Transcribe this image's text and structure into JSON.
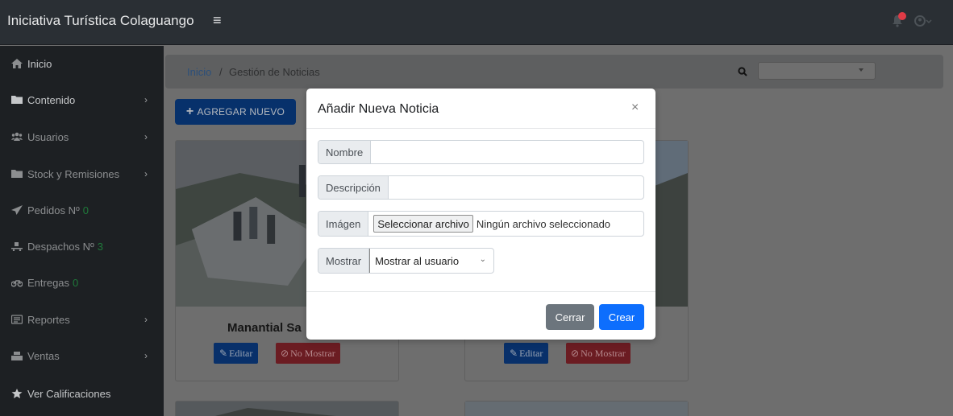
{
  "app": {
    "title": "Iniciativa Turística Colaguango"
  },
  "topbar": {
    "menu_icon": "hamburger-icon",
    "bell_icon": "bell-icon",
    "user_icon": "user-icon"
  },
  "sidebar": {
    "items": [
      {
        "label": "Inicio",
        "icon": "home-icon",
        "arrow": "",
        "num": ""
      },
      {
        "label": "Contenido",
        "icon": "folder-icon",
        "arrow": "›",
        "num": ""
      },
      {
        "label": "Usuarios",
        "icon": "users-icon",
        "arrow": "›",
        "num": ""
      },
      {
        "label": "Stock y Remisiones",
        "icon": "folder-icon",
        "arrow": "›",
        "num": ""
      },
      {
        "label": "Pedidos Nº",
        "icon": "send-icon",
        "arrow": "",
        "num": "0"
      },
      {
        "label": "Despachos Nº",
        "icon": "dolly-icon",
        "arrow": "",
        "num": "3"
      },
      {
        "label": "Entregas",
        "icon": "motorcycle-icon",
        "arrow": "",
        "num": "0"
      },
      {
        "label": "Reportes",
        "icon": "report-icon",
        "arrow": "›",
        "num": ""
      },
      {
        "label": "Ventas",
        "icon": "cash-register-icon",
        "arrow": "›",
        "num": ""
      },
      {
        "label": "Ver Calificaciones",
        "icon": "star-icon",
        "arrow": "",
        "num": ""
      }
    ]
  },
  "breadcrumb": {
    "home": "Inicio",
    "separator": "/",
    "current": "Gestión de Noticias"
  },
  "toolbar": {
    "add_label": "AGREGAR NUEVO"
  },
  "cards": [
    {
      "title": "Manantial Sa",
      "edit_label": "Editar",
      "hide_label": "No Mostrar"
    },
    {
      "title": "",
      "edit_label": "Editar",
      "hide_label": "No Mostrar"
    }
  ],
  "modal": {
    "title": "Añadir Nueva Noticia",
    "close": "×",
    "fields": {
      "nombre_label": "Nombre",
      "nombre_value": "",
      "descripcion_label": "Descripción",
      "descripcion_value": "",
      "imagen_label": "Imágen",
      "file_button": "Seleccionar archivo",
      "file_status": "Ningún archivo seleccionado",
      "mostrar_label": "Mostrar",
      "mostrar_value": "Mostrar al usuario"
    },
    "cerrar_label": "Cerrar",
    "crear_label": "Crear"
  },
  "colors": {
    "primary": "#0d6efd",
    "secondary": "#6c757d",
    "danger": "#dc3545",
    "topbar": "#2a2f34",
    "sidebar": "#1d2023"
  }
}
